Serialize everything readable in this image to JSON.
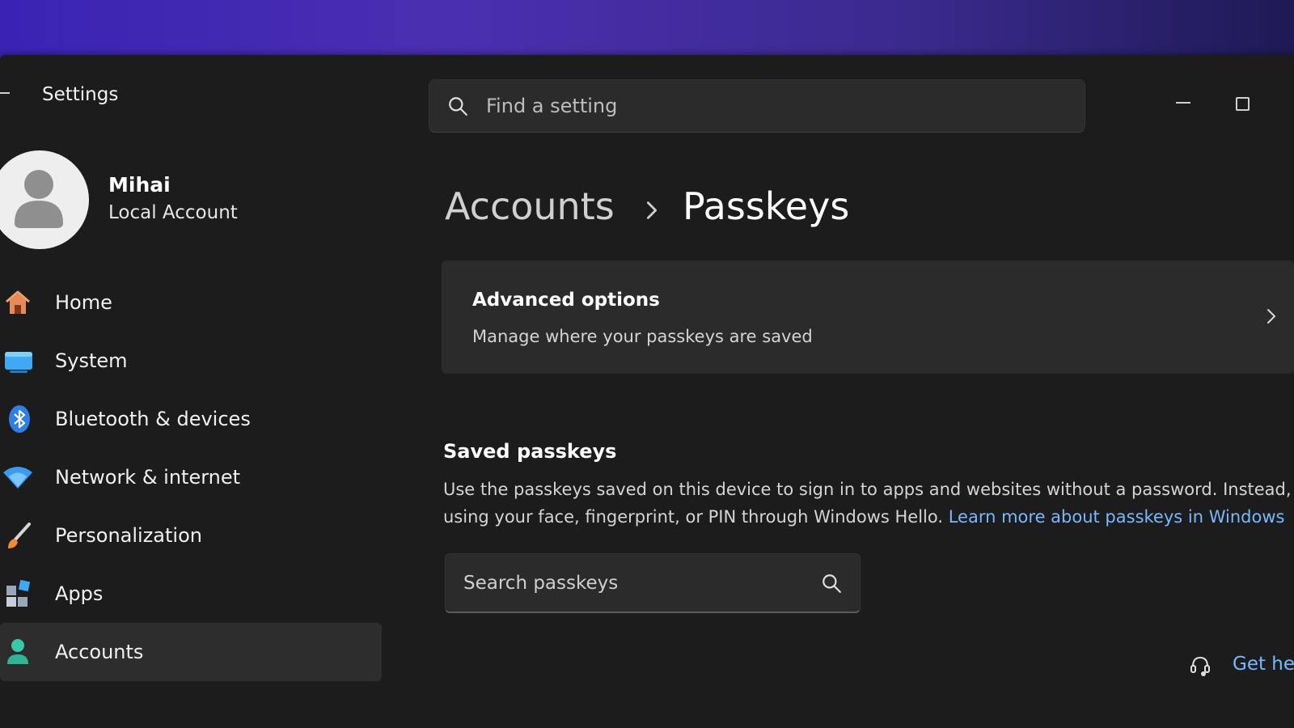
{
  "app": {
    "title": "Settings"
  },
  "search": {
    "placeholder": "Find a setting"
  },
  "profile": {
    "name": "Mihai",
    "account_type": "Local Account"
  },
  "nav": {
    "items": [
      {
        "label": "Home",
        "icon": "home-icon"
      },
      {
        "label": "System",
        "icon": "system-display-icon"
      },
      {
        "label": "Bluetooth & devices",
        "icon": "bluetooth-icon"
      },
      {
        "label": "Network & internet",
        "icon": "wifi-icon"
      },
      {
        "label": "Personalization",
        "icon": "paintbrush-icon"
      },
      {
        "label": "Apps",
        "icon": "apps-icon"
      },
      {
        "label": "Accounts",
        "icon": "person-icon",
        "selected": true
      }
    ]
  },
  "breadcrumb": {
    "parent": "Accounts",
    "current": "Passkeys"
  },
  "advanced_card": {
    "title": "Advanced options",
    "description": "Manage where your passkeys are saved"
  },
  "saved_passkeys": {
    "title": "Saved passkeys",
    "description_line1": "Use the passkeys saved on this device to sign in to apps and websites without a password. Instead, your passke",
    "description_line2": "using your face, fingerprint, or PIN through Windows Hello.",
    "learn_more": "Learn more about passkeys in Windows",
    "search_placeholder": "Search passkeys"
  },
  "help": {
    "label": "Get help"
  },
  "colors": {
    "accent_link": "#79b8ff",
    "background": "#1c1c1c",
    "card": "#2b2b2b"
  }
}
